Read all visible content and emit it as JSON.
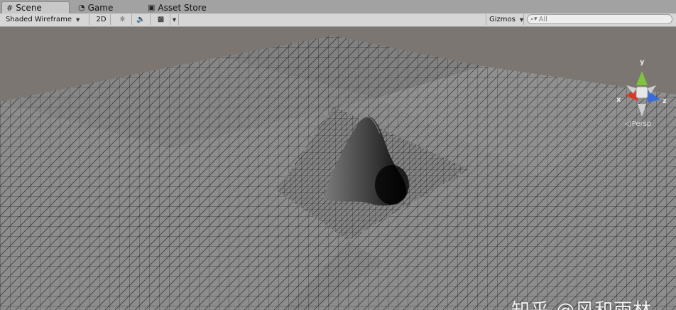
{
  "tabs": [
    {
      "label": "Scene",
      "icon": "grid-icon"
    },
    {
      "label": "Game",
      "icon": "pacman-icon"
    },
    {
      "label": "Asset Store",
      "icon": "bag-icon"
    }
  ],
  "toolbar": {
    "draw_mode": "Shaded Wireframe",
    "mode_2d": "2D",
    "gizmos_label": "Gizmos",
    "search_placeholder": "All"
  },
  "scene": {
    "gizmo_axes": {
      "y": "y",
      "x": "x",
      "z": "z"
    },
    "projection": "Persp",
    "colors": {
      "x_axis": "#d8372b",
      "y_axis": "#7fc53b",
      "z_axis": "#3b6bd8",
      "grid": "#2a2a2a",
      "plane": "#8c8c8c"
    }
  },
  "watermark": "知乎 @风和雨林"
}
